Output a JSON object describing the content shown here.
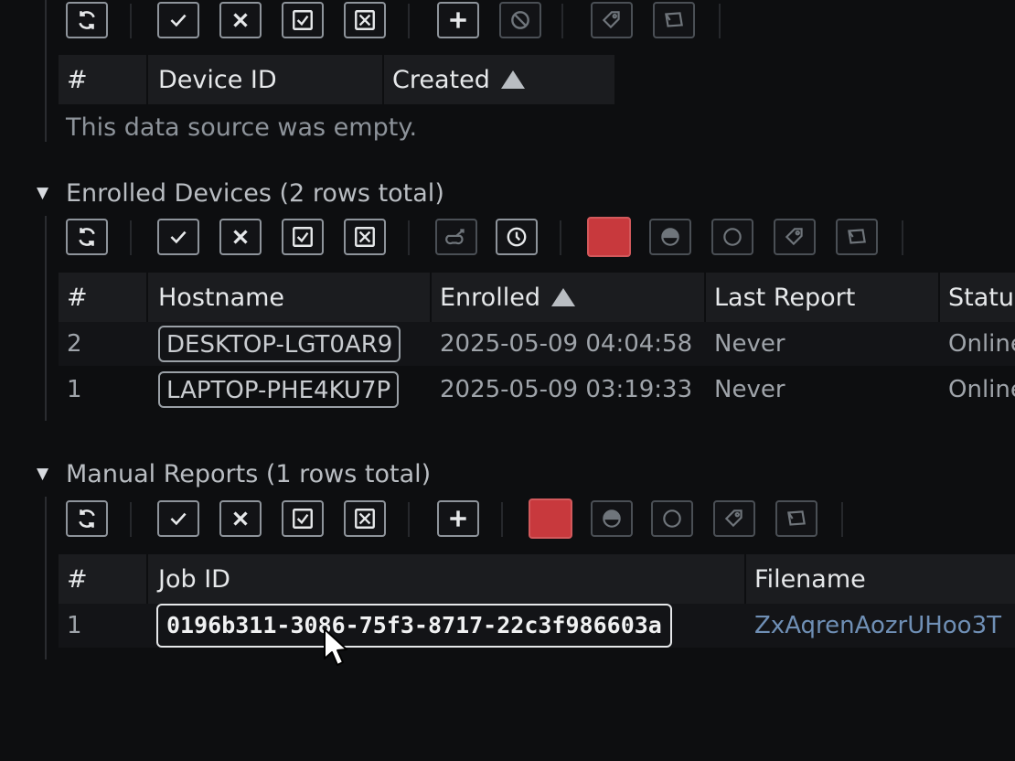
{
  "top_section": {
    "columns": [
      "#",
      "Device ID",
      "Created"
    ],
    "empty_text": "This data source was empty."
  },
  "enrolled": {
    "title": "Enrolled Devices (2 rows total)",
    "columns": [
      "#",
      "Hostname",
      "Enrolled",
      "Last Report",
      "Status"
    ],
    "rows": [
      {
        "num": "2",
        "hostname": "DESKTOP-LGT0AR9",
        "enrolled": "2025-05-09 04:04:58",
        "last_report": "Never",
        "status": "Online"
      },
      {
        "num": "1",
        "hostname": "LAPTOP-PHE4KU7P",
        "enrolled": "2025-05-09 03:19:33",
        "last_report": "Never",
        "status": "Online"
      }
    ]
  },
  "manual": {
    "title": "Manual Reports (1 rows total)",
    "columns": [
      "#",
      "Job ID",
      "Filename"
    ],
    "rows": [
      {
        "num": "1",
        "job_id": "0196b311-3086-75f3-8717-22c3f986603a",
        "filename": "ZxAqrenAozrUHoo3T"
      }
    ]
  },
  "colors": {
    "accent_red": "#c8393d",
    "background": "#0d0e10",
    "header_bg": "#1b1c1f"
  }
}
